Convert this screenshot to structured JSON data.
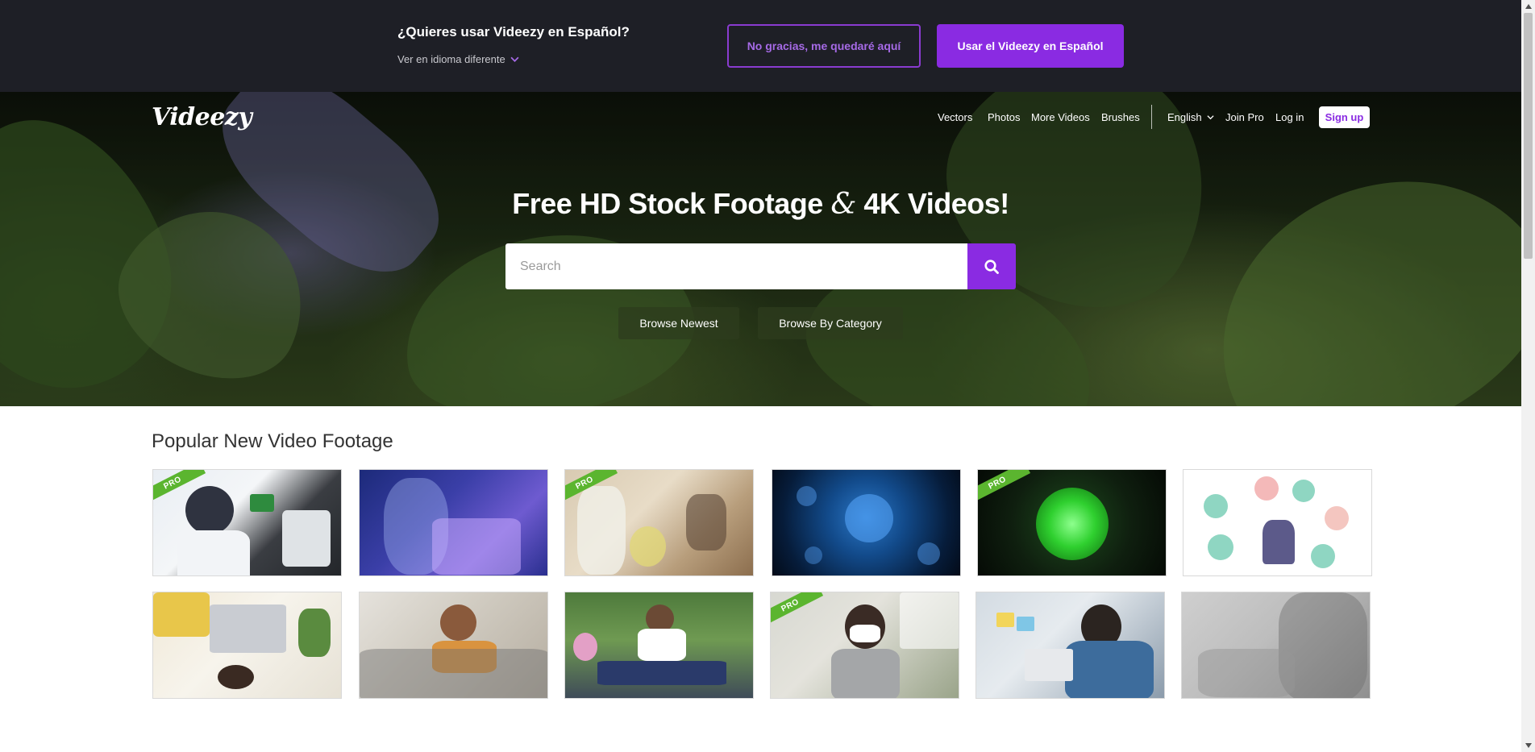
{
  "language_banner": {
    "question": "¿Quieres usar Videezy en Español?",
    "other_language": "Ver en idioma diferente",
    "decline_button": "No gracias, me quedaré aquí",
    "accept_button": "Usar el Videezy en Español"
  },
  "header": {
    "logo": "Videezy",
    "nav": {
      "vectors": "Vectors",
      "photos": "Photos",
      "more_videos": "More Videos",
      "brushes": "Brushes",
      "language": "English",
      "join_pro": "Join Pro",
      "log_in": "Log in",
      "sign_up": "Sign up"
    }
  },
  "hero": {
    "title_part1": "Free HD Stock Footage",
    "title_amp": "&",
    "title_part2": "4K Videos!",
    "search_placeholder": "Search",
    "browse_newest": "Browse Newest",
    "browse_category": "Browse By Category"
  },
  "section": {
    "title": "Popular New Video Footage",
    "pro_badge": "PRO"
  },
  "colors": {
    "accent": "#8a2be2",
    "banner_bg": "#1e1f26",
    "pro_green": "#5bb52f"
  }
}
